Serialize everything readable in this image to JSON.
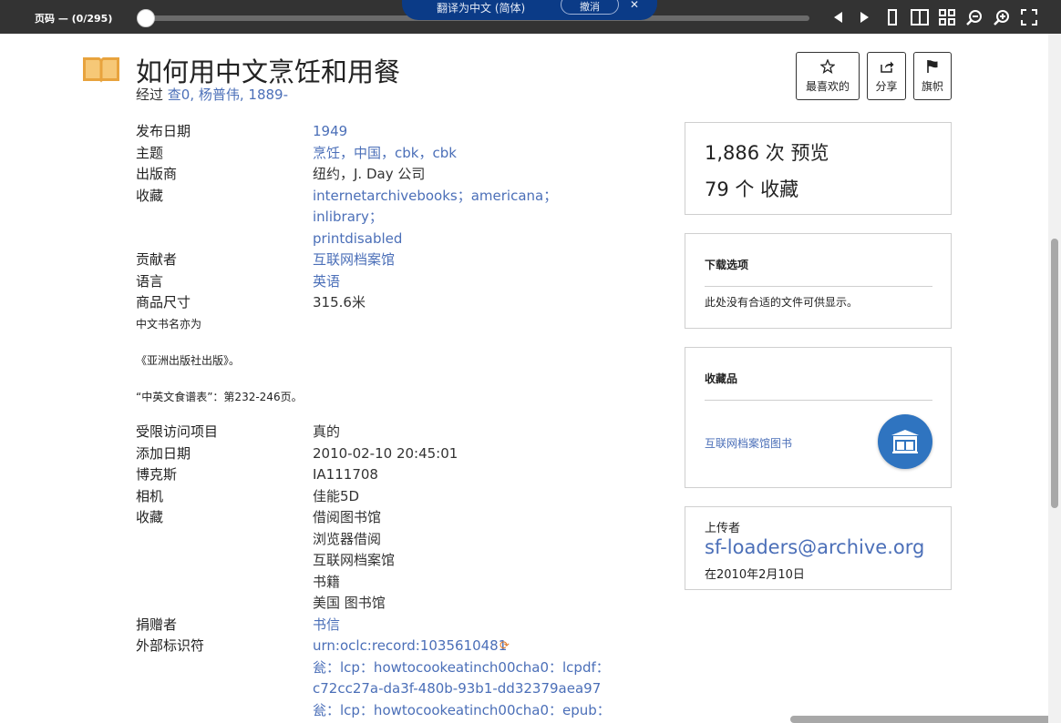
{
  "toolbar": {
    "page_label": "页码 — (0/295)",
    "translate_text": "翻译为中文 (简体)",
    "translate_undo": "撤消",
    "icons": [
      "prev-icon",
      "next-icon",
      "one-page-icon",
      "two-page-icon",
      "thumbnail-icon",
      "zoom-out-icon",
      "zoom-in-icon",
      "fullscreen-icon"
    ]
  },
  "book": {
    "title": "如何用中文烹饪和用餐",
    "by_label": "经过",
    "authors": "查0, 杨普伟, 1889-"
  },
  "actions": {
    "favorite": "最喜欢的",
    "share": "分享",
    "flag": "旗帜"
  },
  "metadata1": [
    {
      "key": "发布日期",
      "value": "1949",
      "link": true
    },
    {
      "key": "主题",
      "value": "烹饪，中国，cbk，cbk",
      "link": true
    },
    {
      "key": "出版商",
      "value": "纽约，J. Day 公司",
      "link": false
    },
    {
      "key": "收藏",
      "value": "internetarchivebooks；americana；inlibrary；",
      "link": true
    },
    {
      "key": "",
      "value": "printdisabled",
      "link": true
    },
    {
      "key": "贡献者",
      "value": "互联网档案馆",
      "link": true
    },
    {
      "key": "语言",
      "value": "英语",
      "link": true
    },
    {
      "key": "商品尺寸",
      "value": "315.6米",
      "link": false
    }
  ],
  "description": [
    "中文书名亦为",
    "《亚洲出版社出版》。",
    "“中英文食谱表”：第232-246页。"
  ],
  "metadata2": [
    {
      "key": "受限访问项目",
      "value": "真的",
      "link": false
    },
    {
      "key": "添加日期",
      "value": "2010-02-10 20:45:01",
      "link": false
    },
    {
      "key": "博克斯",
      "value": "IA111708",
      "link": false
    },
    {
      "key": "相机",
      "value": "佳能5D",
      "link": false
    },
    {
      "key": "收藏",
      "value": "借阅图书馆",
      "link": false
    },
    {
      "key": "",
      "value": "浏览器借阅",
      "link": false
    },
    {
      "key": "",
      "value": "互联网档案馆",
      "link": false
    },
    {
      "key": "",
      "value": "书籍",
      "link": false
    },
    {
      "key": "",
      "value": "美国 图书馆",
      "link": false
    },
    {
      "key": "捐赠者",
      "value": "书信",
      "link": true
    },
    {
      "key": "外部标识符",
      "value": "urn:oclc:record:1035610481",
      "link": true
    },
    {
      "key": "",
      "value": "瓮：lcp：howtocookeatinch00cha0：lcpdf：",
      "link": true
    },
    {
      "key": "",
      "value": "c72cc27a-da3f-480b-93b1-dd32379aea97",
      "link": true
    },
    {
      "key": "",
      "value": "瓮：lcp：howtocookeatinch00cha0：epub：",
      "link": true
    }
  ],
  "stats": {
    "views": "1,886 次 预览",
    "favorites": "79 个 收藏"
  },
  "downloads": {
    "heading": "下载选项",
    "empty_text": "此处没有合适的文件可供显示。"
  },
  "collections": {
    "heading": "收藏品",
    "link": "互联网档案馆图书"
  },
  "uploader": {
    "label": "上传者",
    "email": "sf-loaders@archive.org",
    "date": "在2010年2月10日"
  },
  "colors": {
    "link": "#4b6fb8",
    "toolbar_bg": "#333333",
    "translate_bg": "#0b3b87",
    "collection_circle": "#2f74c0",
    "book_icon": "#e8a33d"
  }
}
